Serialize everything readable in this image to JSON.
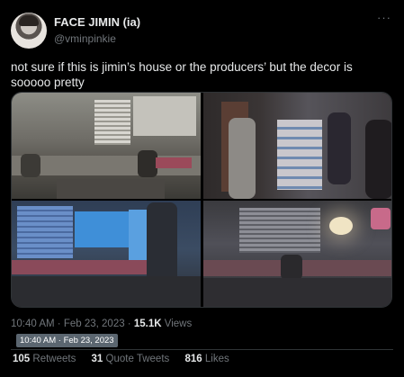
{
  "author": {
    "display_name": "FACE JIMIN (ia)",
    "handle": "@vminpinkie"
  },
  "more_icon": "more-icon",
  "tweet": {
    "text": "not sure if this is jimin’s house or the producers’ but the decor is sooooo pretty"
  },
  "meta": {
    "time": "10:40 AM",
    "separator": " · ",
    "date": "Feb 23, 2023",
    "views_count": "15.1K",
    "views_label": " Views",
    "tooltip": "10:40 AM · Feb 23, 2023"
  },
  "stats": {
    "retweets_count": "105",
    "retweets_label": "Retweets",
    "quote_count": "31",
    "quote_label": "Quote Tweets",
    "likes_count": "816",
    "likes_label": "Likes"
  },
  "colors": {
    "background": "#000000",
    "text": "#e7e9ea",
    "secondary": "#71767b",
    "border": "#2f3336"
  }
}
